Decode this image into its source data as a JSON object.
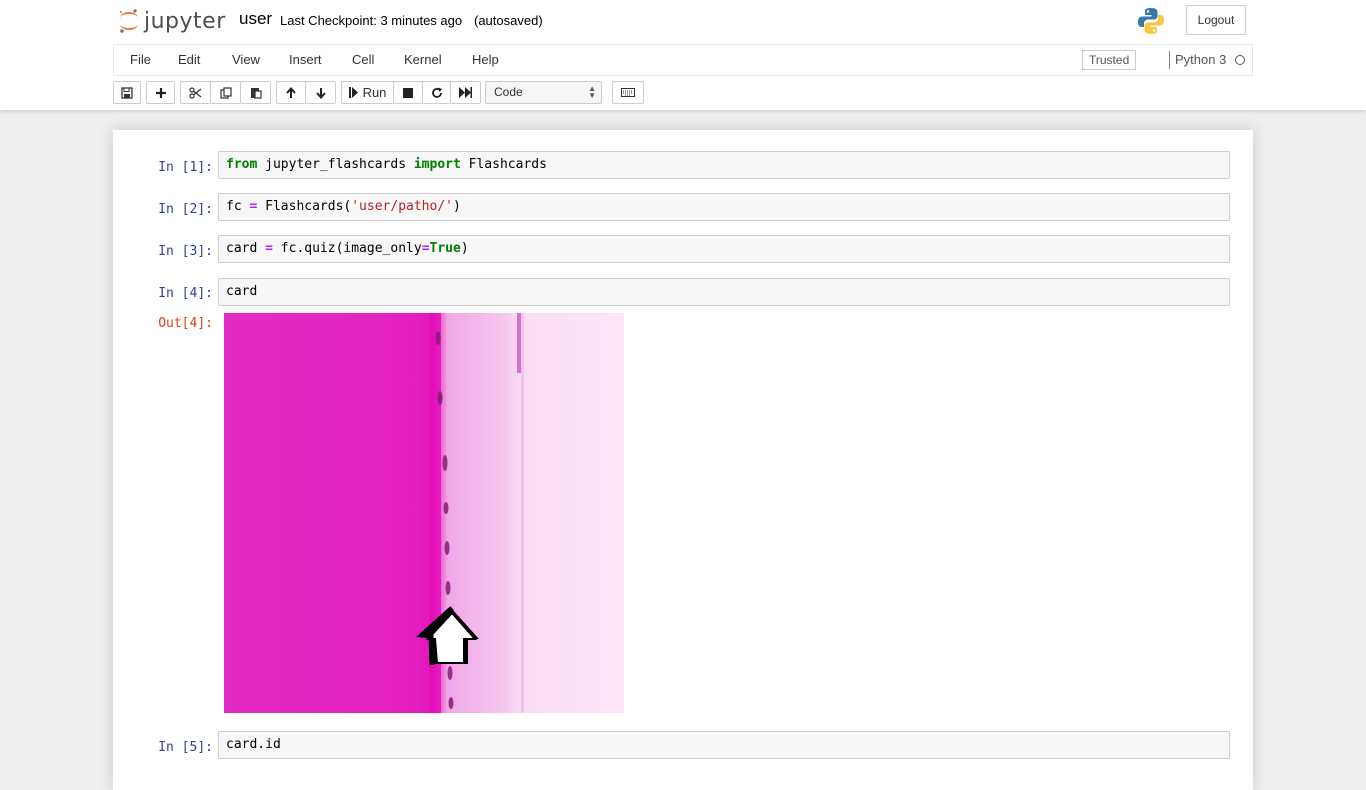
{
  "header": {
    "logo_text": "jupyter",
    "notebook_name": "user",
    "checkpoint": "Last Checkpoint: 3 minutes ago",
    "autosave": "(autosaved)",
    "logout_label": "Logout"
  },
  "menubar": {
    "items": [
      "File",
      "Edit",
      "View",
      "Insert",
      "Cell",
      "Kernel",
      "Help"
    ],
    "trusted_label": "Trusted",
    "kernel_name": "Python 3"
  },
  "toolbar": {
    "run_label": "Run",
    "cell_type": "Code",
    "icons": [
      "save-icon",
      "plus-icon",
      "scissors-icon",
      "copy-icon",
      "paste-icon",
      "arrow-up-icon",
      "arrow-down-icon",
      "step-forward-icon",
      "stop-icon",
      "restart-icon",
      "fast-forward-icon",
      "keyboard-icon"
    ]
  },
  "cells": [
    {
      "prompt": "In [1]:",
      "kw1": "from",
      "mod": " jupyter_flashcards ",
      "kw2": "import",
      "rest": " Flashcards"
    },
    {
      "prompt": "In [2]:",
      "var": "fc ",
      "op": "=",
      "call": " Flashcards(",
      "str": "'user/patho/'",
      "close": ")"
    },
    {
      "prompt": "In [3]:",
      "var": "card ",
      "op": "=",
      "call": " fc.quiz(image_only",
      "op2": "=",
      "kw": "True",
      "close": ")"
    },
    {
      "prompt": "In [4]:",
      "code": "card",
      "out_prompt": "Out[4]:"
    },
    {
      "prompt": "In [5]:",
      "code": "card.id"
    }
  ],
  "colors": {
    "input_prompt": "#303f9f",
    "output_prompt": "#d84315",
    "keyword": "#008000",
    "operator": "#aa22ff",
    "string": "#ba2121",
    "histology_pink": "#e81ec0"
  }
}
